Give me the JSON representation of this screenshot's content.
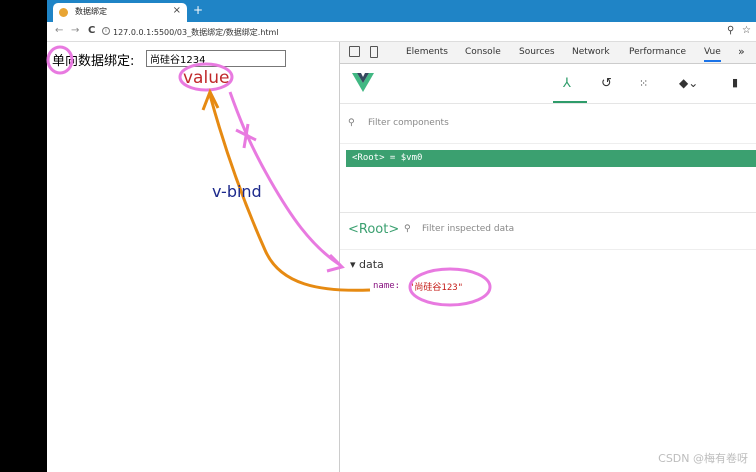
{
  "browser": {
    "tab_title": "数据绑定",
    "tab_close": "×",
    "new_tab": "+",
    "url": "127.0.0.1:5500/03_数据绑定/数据绑定.html",
    "nav": {
      "back": "←",
      "forward": "→",
      "reload": "C"
    },
    "right_icons": [
      "☆",
      "⚲"
    ]
  },
  "page": {
    "field_label": "单向数据绑定:",
    "input_value": "尚硅谷1234"
  },
  "devtools": {
    "tabs": [
      "Elements",
      "Console",
      "Sources",
      "Network",
      "Performance",
      "Vue"
    ],
    "active_tab": "Vue",
    "more": "»",
    "filter_placeholder": "Filter components",
    "root_component": "<Root> = $vm0",
    "inspector_root": "<Root>",
    "inspector_filter": "Filter inspected data",
    "data_section": "▾ data",
    "data_name": "name:",
    "data_value": "\"尚硅谷123\""
  },
  "annotations": {
    "value_label": "value",
    "vbind_label": "v-bind",
    "value_color": "#c0282a",
    "vbind_color": "#1d2a8c",
    "pink": "#e87ae0",
    "orange": "#e68a12"
  },
  "watermark": "CSDN @梅有卷呀"
}
